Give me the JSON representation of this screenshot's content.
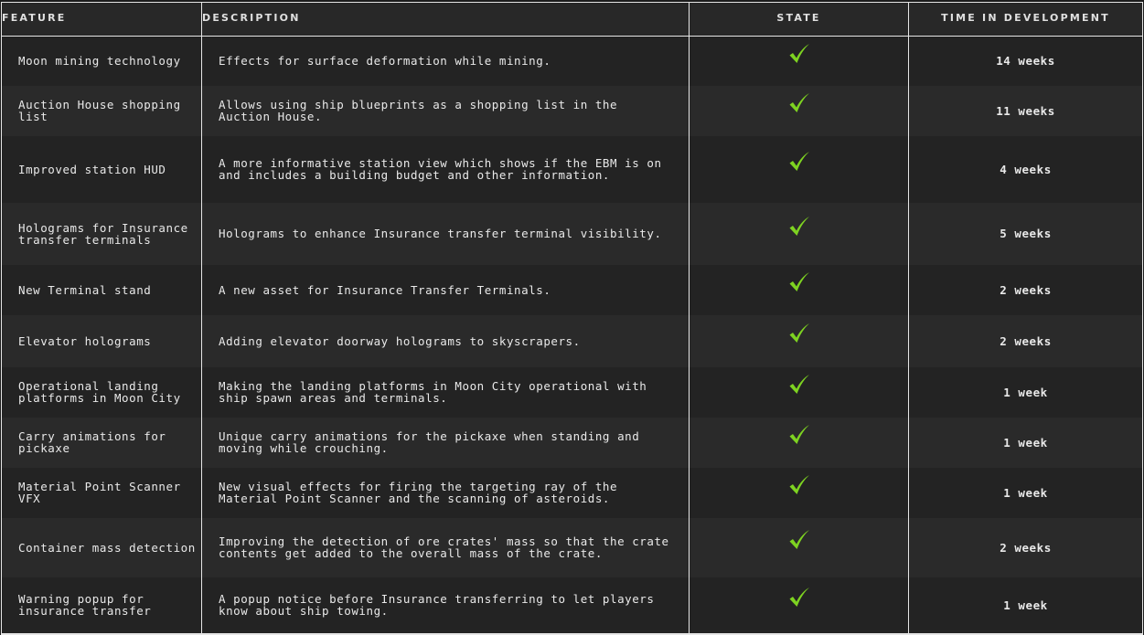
{
  "colors": {
    "background": "#232323",
    "row_alt": "#2a2a2a",
    "grid_line": "#e6e6e6",
    "text": "#e9e9e9",
    "check": "#7ed321"
  },
  "table": {
    "headers": {
      "feature": "Feature",
      "description": "Description",
      "state": "State",
      "time": "Time in Development"
    },
    "rows": [
      {
        "feature": "Moon mining technology",
        "description": "Effects for surface deformation while mining.",
        "state": "check-icon",
        "time": "14 weeks"
      },
      {
        "feature": "Auction House shopping list",
        "description": "Allows using ship blueprints as a shopping list in the Auction House.",
        "state": "check-icon",
        "time": "11 weeks"
      },
      {
        "feature": "Improved station HUD",
        "description": "A more informative station view which shows if the EBM is on and includes a building budget and other information.",
        "state": "check-icon",
        "time": "4 weeks"
      },
      {
        "feature": "Holograms for Insurance transfer terminals",
        "description": "Holograms to enhance Insurance transfer terminal visibility.",
        "state": "check-icon",
        "time": "5 weeks"
      },
      {
        "feature": "New Terminal stand",
        "description": "A new asset for Insurance Transfer Terminals.",
        "state": "check-icon",
        "time": "2 weeks"
      },
      {
        "feature": "Elevator holograms",
        "description": "Adding elevator doorway holograms to skyscrapers.",
        "state": "check-icon",
        "time": "2 weeks"
      },
      {
        "feature": "Operational landing platforms in Moon City",
        "description": "Making the landing platforms in Moon City operational with ship spawn areas and terminals.",
        "state": "check-icon",
        "time": "1 week"
      },
      {
        "feature": "Carry animations for pickaxe",
        "description": "Unique carry animations for the pickaxe when standing and moving while crouching.",
        "state": "check-icon",
        "time": "1 week"
      },
      {
        "feature": "Material Point Scanner VFX",
        "description": "New visual effects for firing the targeting ray of the Material Point Scanner and the scanning of asteroids.",
        "state": "check-icon",
        "time": "1 week"
      },
      {
        "feature": "Container mass detection",
        "description": "Improving the detection of ore crates' mass so that the crate contents get added to the overall mass of the crate.",
        "state": "check-icon",
        "time": "2 weeks"
      },
      {
        "feature": "Warning popup for insurance transfer",
        "description": "A popup notice before Insurance transferring to let players know about ship towing.",
        "state": "check-icon",
        "time": "1 week"
      }
    ]
  }
}
